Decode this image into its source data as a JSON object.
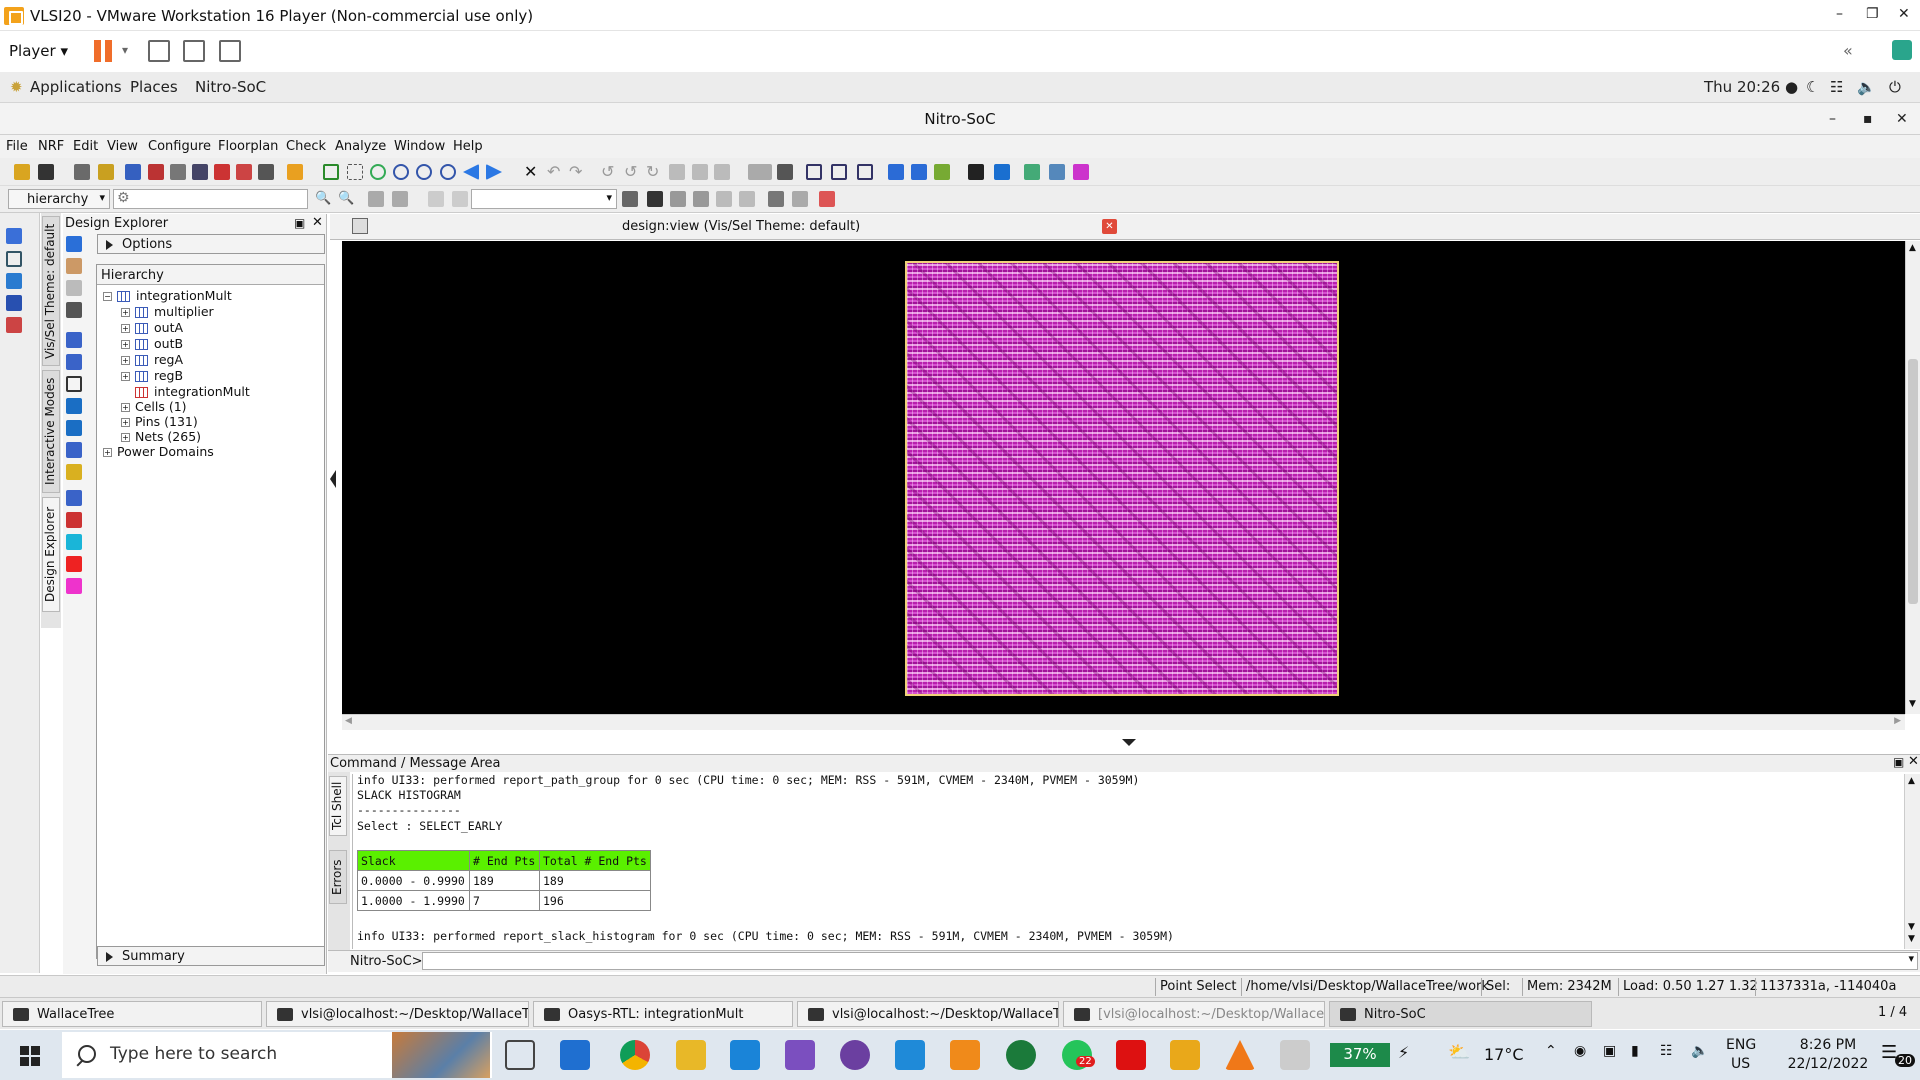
{
  "vm_window": {
    "title": "VLSI20 - VMware Workstation 16 Player (Non-commercial use only)",
    "player_menu": "Player",
    "controls": {
      "minimize": "–",
      "restore": "❐",
      "close": "✕"
    }
  },
  "gnome_bar": {
    "applications": "Applications",
    "places": "Places",
    "app": "Nitro-SoC",
    "clock": "Thu 20:26 ●"
  },
  "app_window": {
    "title": "Nitro-SoC",
    "controls": {
      "minimize": "–",
      "maximize": "▪",
      "close": "✕"
    }
  },
  "menubar": [
    "File",
    "NRF",
    "Edit",
    "View",
    "Configure",
    "Floorplan",
    "Check",
    "Analyze",
    "Window",
    "Help"
  ],
  "toolbar2": {
    "hierarchy_select": "hierarchy"
  },
  "vertical_tabs": [
    "Vis/Sel Theme: default",
    "Interactive Modes",
    "Design Explorer"
  ],
  "design_explorer": {
    "title": "Design Explorer",
    "options_label": "Options",
    "hierarchy_label": "Hierarchy",
    "summary_label": "Summary",
    "tree": {
      "root": "integrationMult",
      "children": [
        "multiplier",
        "outA",
        "outB",
        "regA",
        "regB",
        "integrationMult"
      ],
      "groups": [
        "Cells (1)",
        "Pins (131)",
        "Nets (265)"
      ],
      "power": "Power Domains"
    }
  },
  "design_view": {
    "title": "design:view  (Vis/Sel Theme: default)"
  },
  "command_area": {
    "title": "Command / Message Area",
    "tabs": [
      "Tcl Shell",
      "Errors"
    ],
    "lines_top": [
      "info UI33: performed report_path_group for 0 sec (CPU time: 0 sec; MEM: RSS - 591M, CVMEM - 2340M, PVMEM - 3059M)",
      "SLACK HISTOGRAM",
      "---------------",
      "Select : SELECT_EARLY"
    ],
    "slack_table": {
      "headers": [
        "Slack",
        "# End Pts",
        "Total # End Pts"
      ],
      "rows": [
        [
          "0.0000 - 0.9990",
          "189",
          "189"
        ],
        [
          "1.0000 - 1.9990",
          "7",
          "196"
        ]
      ]
    },
    "line_bottom": "info UI33: performed report_slack_histogram for 0 sec (CPU time: 0 sec; MEM: RSS - 591M, CVMEM - 2340M, PVMEM - 3059M)",
    "prompt": "Nitro-SoC>"
  },
  "status_bar": {
    "mode": "Point Select",
    "path": "/home/vlsi/Desktop/WallaceTree/work",
    "sel": "Sel:",
    "mem": "Mem: 2342M",
    "load": "Load: 0.50 1.27 1.32",
    "coords": "1137331a, -114040a"
  },
  "gnome_tasks": {
    "items": [
      "WallaceTree",
      "vlsi@localhost:~/Desktop/WallaceTr...",
      "Oasys-RTL: integrationMult",
      "vlsi@localhost:~/Desktop/WallaceTr...",
      "[vlsi@localhost:~/Desktop/WallaceT...",
      "Nitro-SoC"
    ],
    "pager": "1 / 4"
  },
  "windows_taskbar": {
    "search_placeholder": "Type here to search",
    "teams_badge": "22",
    "battery": "37%",
    "temperature": "17°C",
    "lang": "ENG",
    "region": "US",
    "time": "8:26 PM",
    "date": "22/12/2022",
    "notifications": "20"
  },
  "colors": {
    "die_fill": "#c23fbf",
    "die_border": "#f0d27a",
    "histogram_header": "#5af000",
    "accent_pause": "#f06d2a"
  }
}
